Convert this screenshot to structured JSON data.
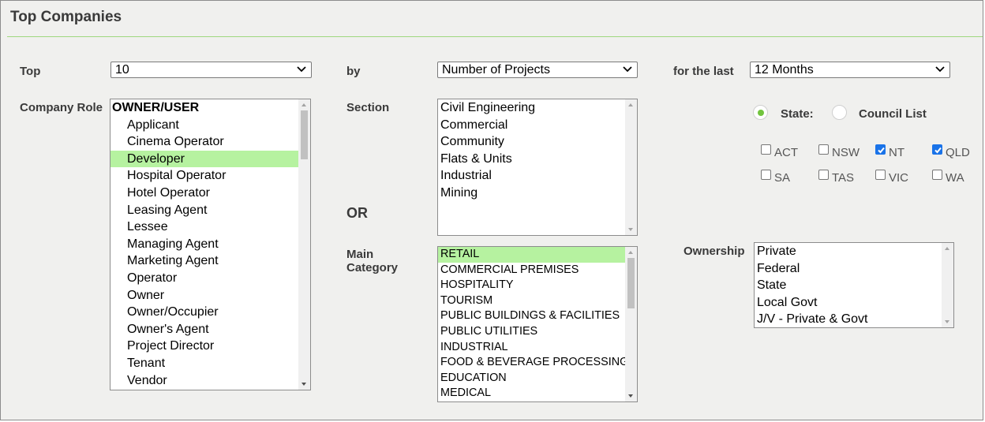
{
  "title": "Top Companies",
  "labels": {
    "top": "Top",
    "by": "by",
    "for_the_last": "for the last",
    "company_role": "Company Role",
    "section": "Section",
    "or": "OR",
    "main_category_1": "Main",
    "main_category_2": "Category",
    "ownership": "Ownership",
    "state": "State:",
    "council_list": "Council List"
  },
  "selects": {
    "top": "10",
    "by": "Number of Projects",
    "period": "12 Months"
  },
  "company_role": {
    "items": [
      "OWNER/USER",
      "Applicant",
      "Cinema Operator",
      "Developer",
      "Hospital Operator",
      "Hotel Operator",
      "Leasing Agent",
      "Lessee",
      "Managing Agent",
      "Marketing Agent",
      "Operator",
      "Owner",
      "Owner/Occupier",
      "Owner's Agent",
      "Project Director",
      "Tenant",
      "Vendor"
    ],
    "group_header": "OWNER/USER",
    "selected": "Developer"
  },
  "section": {
    "items": [
      "Civil Engineering",
      "Commercial",
      "Community",
      "Flats & Units",
      "Industrial",
      "Mining"
    ]
  },
  "main_category": {
    "items": [
      "RETAIL",
      "COMMERCIAL PREMISES",
      "HOSPITALITY",
      "TOURISM",
      "PUBLIC BUILDINGS & FACILITIES",
      "PUBLIC UTILITIES",
      "INDUSTRIAL",
      "FOOD & BEVERAGE PROCESSING",
      "EDUCATION",
      "MEDICAL"
    ],
    "selected": "RETAIL"
  },
  "ownership": {
    "items": [
      "Private",
      "Federal",
      "State",
      "Local Govt",
      "J/V - Private & Govt"
    ]
  },
  "location_mode": "State:",
  "states": [
    {
      "label": "ACT",
      "checked": false
    },
    {
      "label": "NSW",
      "checked": false
    },
    {
      "label": "NT",
      "checked": true
    },
    {
      "label": "QLD",
      "checked": true
    },
    {
      "label": "SA",
      "checked": false
    },
    {
      "label": "TAS",
      "checked": false
    },
    {
      "label": "VIC",
      "checked": false
    },
    {
      "label": "WA",
      "checked": false
    }
  ],
  "colors": {
    "accent_green": "#72c43e",
    "selected_row": "#b6f2a0",
    "checkbox_blue": "#1a73e8",
    "rule_green": "#9fd77f"
  }
}
